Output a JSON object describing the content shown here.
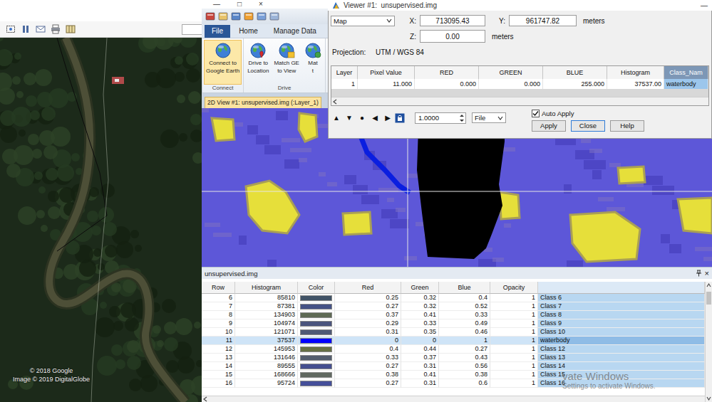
{
  "google_earth": {
    "attribution": [
      "© 2018 Google",
      "Image © 2019 DigitalGlobe"
    ]
  },
  "erdas": {
    "caption_buttons": [
      "—",
      "□",
      "×"
    ],
    "tabs": [
      {
        "label": "File",
        "selected": true
      },
      {
        "label": "Home",
        "selected": false
      },
      {
        "label": "Manage Data",
        "selected": false
      }
    ],
    "ribbon_groups": [
      {
        "label": "Connect",
        "buttons": [
          {
            "lines": [
              "Connect to",
              "Google Earth"
            ],
            "selected": true
          }
        ]
      },
      {
        "label": "Drive",
        "buttons": [
          {
            "lines": [
              "Drive to",
              "Location"
            ],
            "selected": false
          },
          {
            "lines": [
              "Match GE",
              "to View"
            ],
            "selected": false
          },
          {
            "lines": [
              "Mat",
              "t"
            ],
            "selected": false
          }
        ]
      }
    ],
    "view_tab": {
      "label": "2D View #1: unsupervised.img (:Layer_1)",
      "selected": true
    }
  },
  "viewer": {
    "title": "Viewer #1:  unsupervised.img",
    "minimize": "—",
    "coord_mode": "Map",
    "coord_rows": [
      [
        {
          "label": "X:",
          "value": "713095.43",
          "units": ""
        },
        {
          "label": "Y:",
          "value": "961747.82",
          "units": "meters"
        }
      ],
      [
        {
          "label": "Z:",
          "value": "0.00",
          "units": "meters"
        }
      ]
    ],
    "projection_label": "Projection:",
    "projection": "UTM / WGS 84",
    "table": {
      "columns": [
        {
          "label": "Layer",
          "selected": false
        },
        {
          "label": "Pixel Value",
          "selected": false
        },
        {
          "label": "RED",
          "selected": false
        },
        {
          "label": "GREEN",
          "selected": false
        },
        {
          "label": "BLUE",
          "selected": false
        },
        {
          "label": "Histogram",
          "selected": false
        },
        {
          "label": "Class_Nam",
          "selected": true
        }
      ],
      "rows": [
        {
          "cells": [
            "1",
            "11.000",
            "0.000",
            "0.000",
            "255.000",
            "37537.00",
            "waterbody"
          ],
          "selected": true
        }
      ]
    },
    "nav_buttons": [
      "▲",
      "▼",
      "●",
      "◀",
      "▶"
    ],
    "zoom": "1.0000",
    "file_menu": "File",
    "auto_apply": {
      "label": "Auto Apply",
      "checked": true
    },
    "buttons": [
      {
        "label": "Apply",
        "default": false
      },
      {
        "label": "Close",
        "default": true
      },
      {
        "label": "Help",
        "default": false
      }
    ]
  },
  "attribute_table": {
    "title": "unsupervised.img",
    "close": "×",
    "columns": [
      {
        "label": "Row",
        "selected": false
      },
      {
        "label": "Histogram",
        "selected": false
      },
      {
        "label": "Color",
        "selected": false
      },
      {
        "label": "Red",
        "selected": false
      },
      {
        "label": "Green",
        "selected": false
      },
      {
        "label": "Blue",
        "selected": false
      },
      {
        "label": "Opacity",
        "selected": false
      },
      {
        "label": "",
        "selected": true
      }
    ],
    "rows": [
      {
        "row": "6",
        "histogram": "85810",
        "red": "0.25",
        "green": "0.32",
        "blue": "0.4",
        "opacity": "1",
        "name": "Class 6",
        "selected": false
      },
      {
        "row": "7",
        "histogram": "87381",
        "red": "0.27",
        "green": "0.32",
        "blue": "0.52",
        "opacity": "1",
        "name": "Class 7",
        "selected": false
      },
      {
        "row": "8",
        "histogram": "134903",
        "red": "0.37",
        "green": "0.41",
        "blue": "0.33",
        "opacity": "1",
        "name": "Class 8",
        "selected": false
      },
      {
        "row": "9",
        "histogram": "104974",
        "red": "0.29",
        "green": "0.33",
        "blue": "0.49",
        "opacity": "1",
        "name": "Class 9",
        "selected": false
      },
      {
        "row": "10",
        "histogram": "121071",
        "red": "0.31",
        "green": "0.35",
        "blue": "0.46",
        "opacity": "1",
        "name": "Class 10",
        "selected": false
      },
      {
        "row": "11",
        "histogram": "37537",
        "red": "0",
        "green": "0",
        "blue": "1",
        "opacity": "1",
        "name": "waterbody",
        "selected": true
      },
      {
        "row": "12",
        "histogram": "145953",
        "red": "0.4",
        "green": "0.44",
        "blue": "0.27",
        "opacity": "1",
        "name": "Class 12",
        "selected": false
      },
      {
        "row": "13",
        "histogram": "131646",
        "red": "0.33",
        "green": "0.37",
        "blue": "0.43",
        "opacity": "1",
        "name": "Class 13",
        "selected": false
      },
      {
        "row": "14",
        "histogram": "89555",
        "red": "0.27",
        "green": "0.31",
        "blue": "0.56",
        "opacity": "1",
        "name": "Class 14",
        "selected": false
      },
      {
        "row": "15",
        "histogram": "168666",
        "red": "0.38",
        "green": "0.41",
        "blue": "0.38",
        "opacity": "1",
        "name": "Class 15",
        "selected": false
      },
      {
        "row": "16",
        "histogram": "95724",
        "red": "0.27",
        "green": "0.31",
        "blue": "0.6",
        "opacity": "1",
        "name": "Class 16",
        "selected": false
      }
    ],
    "watermark": [
      "vate Windows",
      "Settings to activate Windows."
    ]
  }
}
